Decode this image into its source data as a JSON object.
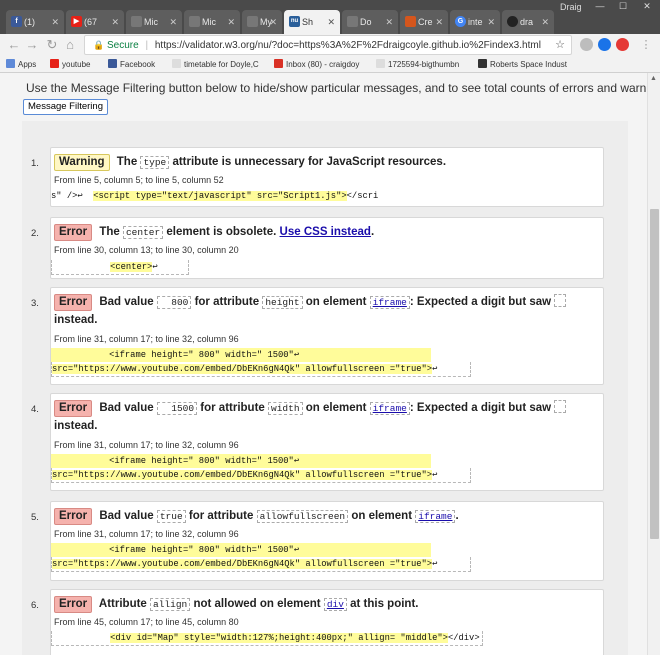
{
  "browser": {
    "profile_name": "Draig",
    "window_controls": [
      "—",
      "☐",
      "✕"
    ],
    "tabs": [
      {
        "label": "(1)",
        "icon": "facebook-icon",
        "color": "#3b5998",
        "glyph": "f"
      },
      {
        "label": "(67",
        "icon": "youtube-icon",
        "color": "#e62117",
        "glyph": "▶"
      },
      {
        "label": "Mic",
        "icon": "page-icon",
        "color": "#777777",
        "glyph": ""
      },
      {
        "label": "Mic",
        "icon": "page-icon",
        "color": "#777777",
        "glyph": ""
      },
      {
        "label": "My",
        "icon": "page-icon",
        "color": "#777777",
        "glyph": ""
      },
      {
        "label": "Sh",
        "icon": "validator-icon",
        "color": "#2a5f9a",
        "glyph": "nu",
        "active": true
      },
      {
        "label": "Do",
        "icon": "page-icon",
        "color": "#777777",
        "glyph": ""
      },
      {
        "label": "Cre",
        "icon": "page-icon",
        "color": "#d5561d",
        "glyph": ""
      },
      {
        "label": "inte",
        "icon": "google-icon",
        "color": "#4285f4",
        "glyph": "G"
      },
      {
        "label": "dra",
        "icon": "github-icon",
        "color": "#222222",
        "glyph": "●"
      }
    ],
    "address": {
      "secure_label": "Secure",
      "url": "https://validator.w3.org/nu/?doc=https%3A%2F%2Fdraigcoyle.github.io%2Findex3.html"
    },
    "bookmarks": [
      {
        "label": "Apps",
        "color": "#5f8ad8"
      },
      {
        "label": "youtube",
        "color": "#e62117"
      },
      {
        "label": "Facebook",
        "color": "#3b5998"
      },
      {
        "label": "timetable for Doyle,C",
        "color": "#dddddd"
      },
      {
        "label": "Inbox (80) - craigdoy",
        "color": "#d93025"
      },
      {
        "label": "1725594-bigthumbn",
        "color": "#dddddd"
      },
      {
        "label": "Roberts Space Indust",
        "color": "#333333"
      }
    ]
  },
  "page": {
    "intro": "Use the Message Filtering button below to hide/show particular messages, and to see total counts of errors and warnings.",
    "filter_button": "Message Filtering",
    "messages": [
      {
        "num": "1.",
        "type": "Warning",
        "pre": "The",
        "code1": "type",
        "post": "attribute is unnecessary for JavaScript resources.",
        "location": "From line 5, column 5; to line 5, column 52",
        "extract_a": "s\" />↩  ",
        "extract_hl": "<script type=\"text/javascript\" src=\"Script1.js\">",
        "extract_b": "</scri"
      },
      {
        "num": "2.",
        "type": "Error",
        "pre": "The",
        "code1": "center",
        "post": "element is obsolete.",
        "link": "Use CSS instead",
        "link_end": ".",
        "location": "From line 30, column 13; to line 30, column 20",
        "extract_a": "           ",
        "extract_hl": "<center>",
        "extract_b": "↩  "
      },
      {
        "num": "3.",
        "type": "Error",
        "pre": "Bad value",
        "code1": "  800",
        "mid1": "for attribute",
        "code2": "height",
        "mid2": "on element",
        "code3": "iframe",
        "post": ": Expected a digit but saw",
        "cont": "instead.",
        "location": "From line 31, column 17; to line 32, column 96",
        "line1": "           <iframe height=\" 800\" width=\" 1500\"↩",
        "line2": "src=\"https://www.youtube.com/embed/DbEKn6gN4Qk\" allowfullscreen =\"true\">",
        "line2_tail": "↩   "
      },
      {
        "num": "4.",
        "type": "Error",
        "pre": "Bad value",
        "code1": "  1500",
        "mid1": "for attribute",
        "code2": "width",
        "mid2": "on element",
        "code3": "iframe",
        "post": ": Expected a digit but saw",
        "cont": "instead.",
        "location": "From line 31, column 17; to line 32, column 96",
        "line1": "           <iframe height=\" 800\" width=\" 1500\"↩",
        "line2": "src=\"https://www.youtube.com/embed/DbEKn6gN4Qk\" allowfullscreen =\"true\">",
        "line2_tail": "↩   "
      },
      {
        "num": "5.",
        "type": "Error",
        "pre": "Bad value",
        "code1": "true",
        "mid1": "for attribute",
        "code2": "allowfullscreen",
        "mid2": "on element",
        "code3": "iframe",
        "post": ".",
        "location": "From line 31, column 17; to line 32, column 96",
        "line1": "           <iframe height=\" 800\" width=\" 1500\"↩",
        "line2": "src=\"https://www.youtube.com/embed/DbEKn6gN4Qk\" allowfullscreen =\"true\">",
        "line2_tail": "↩   "
      },
      {
        "num": "6.",
        "type": "Error",
        "pre": "Attribute",
        "code1": "allign",
        "mid1": "not allowed on element",
        "code2": "div",
        "post": "at this point.",
        "location": "From line 45, column 17; to line 45, column 80",
        "extract_a": "           ",
        "extract_hl": "<div id=\"Map\" style=\"width:127%;height:400px;\" allign= \"middle\">",
        "extract_b": "</div>"
      }
    ]
  }
}
